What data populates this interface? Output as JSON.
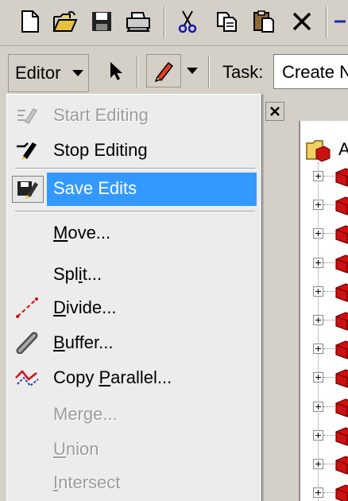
{
  "toolbar": {
    "buttons": [
      {
        "name": "new-file-icon"
      },
      {
        "name": "open-folder-icon"
      },
      {
        "name": "save-icon"
      },
      {
        "name": "print-icon"
      },
      {
        "name": "cut-icon"
      },
      {
        "name": "copy-icon"
      },
      {
        "name": "paste-icon"
      },
      {
        "name": "delete-icon"
      }
    ]
  },
  "editor_toolbar": {
    "editor_label": "Editor",
    "task_label": "Task:",
    "task_value": "Create N"
  },
  "toc": {
    "root_label": "A",
    "layer_icon": "layer-group-icon",
    "layer_count": 12
  },
  "menu": {
    "items": [
      {
        "label": "Start Editing",
        "icon": "start-editing-icon",
        "enabled": false,
        "selected": false
      },
      {
        "label": "Stop Editing",
        "icon": "stop-editing-icon",
        "enabled": true,
        "selected": false
      },
      {
        "label": "Save Edits",
        "icon": "save-edits-icon",
        "enabled": true,
        "selected": true
      },
      {
        "label": "Move...",
        "icon": "",
        "enabled": true,
        "selected": false
      },
      {
        "label": "Split...",
        "icon": "",
        "enabled": true,
        "selected": false
      },
      {
        "label": "Divide...",
        "icon": "divide-icon",
        "enabled": true,
        "selected": false
      },
      {
        "label": "Buffer...",
        "icon": "buffer-icon",
        "enabled": true,
        "selected": false
      },
      {
        "label": "Copy Parallel...",
        "icon": "copy-parallel-icon",
        "enabled": true,
        "selected": false
      },
      {
        "label": "Merge...",
        "icon": "",
        "enabled": false,
        "selected": false
      },
      {
        "label": "Union",
        "icon": "",
        "enabled": false,
        "selected": false
      },
      {
        "label": "Intersect",
        "icon": "",
        "enabled": false,
        "selected": false
      }
    ]
  },
  "colors": {
    "highlight": "#3399ff",
    "chrome": "#d4d0c8",
    "menu_bg": "#ececec",
    "disabled_text": "#9d9d9d",
    "layer_red": "#cc1111"
  }
}
